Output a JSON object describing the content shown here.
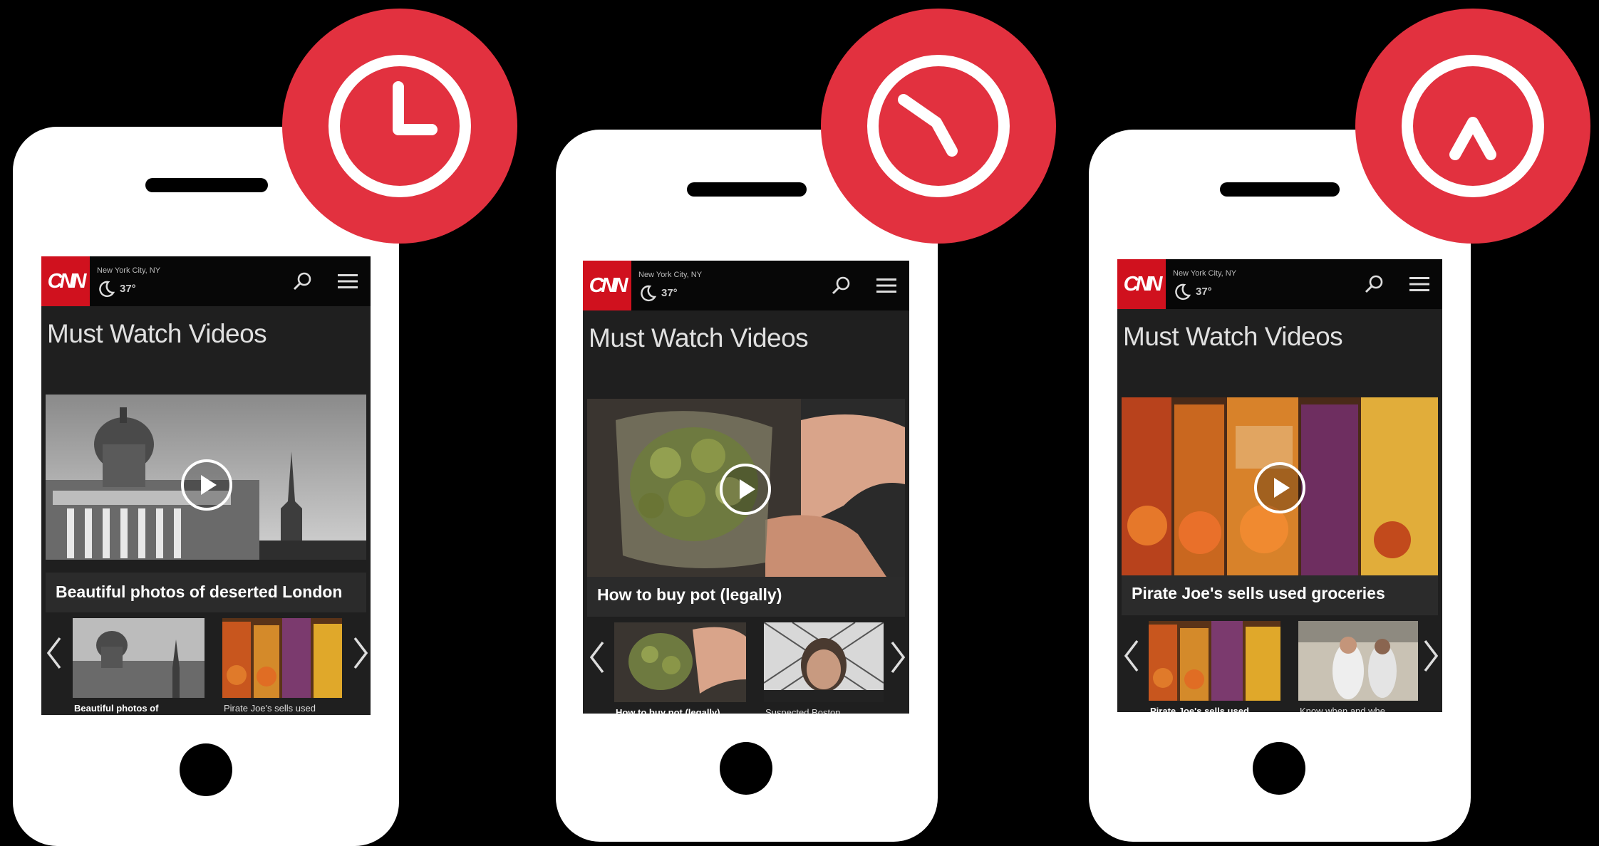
{
  "colors": {
    "accent": "#e2313f",
    "cnn_red": "#d0111e",
    "screen_bg": "#1f1f1f"
  },
  "phones": [
    {
      "badge_icon": "clock-icon",
      "logo": "CNN",
      "location": "New York City, NY",
      "temperature": "37°",
      "heading": "Must Watch Videos",
      "hero_caption": "Beautiful photos of deserted London",
      "thumbs": [
        "Beautiful photos of",
        "Pirate Joe's sells used"
      ]
    },
    {
      "badge_icon": "timer-hand-icon",
      "logo": "CNN",
      "location": "New York City, NY",
      "temperature": "37°",
      "heading": "Must Watch Videos",
      "hero_caption": "How to buy pot (legally)",
      "thumbs": [
        "How to buy pot (legally)",
        "Suspected Boston"
      ]
    },
    {
      "badge_icon": "caret-up-icon",
      "logo": "CNN",
      "location": "New York City, NY",
      "temperature": "37°",
      "heading": "Must Watch Videos",
      "hero_caption": "Pirate Joe's sells used groceries",
      "thumbs": [
        "Pirate Joe's sells used",
        "Know when and whe"
      ]
    }
  ]
}
